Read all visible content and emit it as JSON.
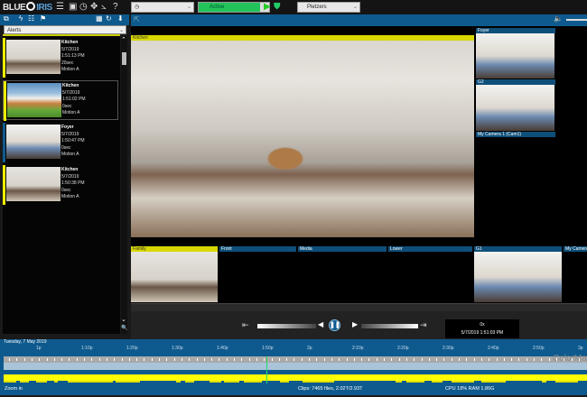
{
  "app": {
    "logo": "BLUE IRIS"
  },
  "toolbar": {
    "icons": [
      "list-icon",
      "camera-icon",
      "clock-icon",
      "move-icon",
      "chart-icon",
      "help-icon"
    ],
    "schedule_dropdown": "",
    "profile_dropdown": "Active",
    "layout_dropdown": "Pletzers",
    "colors": {
      "active": "#22c35a",
      "accent": "#0e5a8e",
      "alert": "#e6e600"
    }
  },
  "sidebar": {
    "filter": "Alerts",
    "alerts": [
      {
        "camera": "Kitchen",
        "date": "5/7/2019",
        "time": "1:51:13 PM",
        "duration": "20sec",
        "trigger": "Motion A"
      },
      {
        "camera": "Kitchen",
        "date": "5/7/2019",
        "time": "1:51:02 PM",
        "duration": "0sec",
        "trigger": "Motion A"
      },
      {
        "camera": "Foyer",
        "date": "5/7/2019",
        "time": "1:50:47 PM",
        "duration": "0sec",
        "trigger": "Motion A"
      },
      {
        "camera": "Kitchen",
        "date": "5/7/2019",
        "time": "1:50:38 PM",
        "duration": "0sec",
        "trigger": "Motion A"
      }
    ]
  },
  "cameras": {
    "main": "Kitchen",
    "side": [
      "Foyer",
      "G2",
      "My Camera 1 (Cam1)"
    ],
    "bottom": [
      "Family",
      "Front",
      "Media",
      "Lower",
      "G1",
      "My Camera"
    ]
  },
  "playback": {
    "speed": "0x",
    "timestamp": "5/7/2019 1:51:03 PM"
  },
  "timeline": {
    "date": "Tuesday, 7 May 2019",
    "ticks": [
      "1p",
      "1:10p",
      "1:20p",
      "1:30p",
      "1:40p",
      "1:50p",
      "2p",
      "2:10p",
      "2:20p",
      "2:30p",
      "2:40p",
      "2:50p",
      "3p"
    ],
    "watermark": "ColorMa"
  },
  "status": {
    "left": "Zoom in",
    "clips": "Clips: 7465 files, 2.02T/2.93T",
    "system": "CPU 18% RAM 1.86G"
  }
}
